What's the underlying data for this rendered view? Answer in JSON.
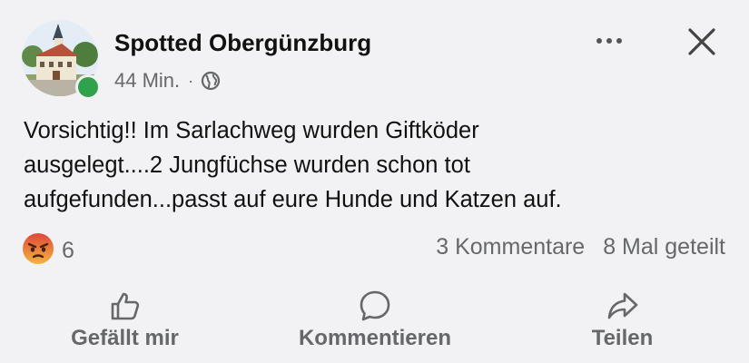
{
  "post": {
    "page_name": "Spotted Obergünzburg",
    "timestamp": "44 Min.",
    "separator": "·",
    "audience_icon": "globe-icon",
    "online_status_color": "#31a24c",
    "text_line1": "Vorsichtig!! Im Sarlachweg wurden Giftköder",
    "text_line2": "ausgelegt....2 Jungfüchse wurden schon tot",
    "text_line3": "aufgefunden...passt auf eure Hunde und Katzen auf."
  },
  "engagement": {
    "reaction_icon": "angry-reaction-icon",
    "reaction_count": "6",
    "comments": "3 Kommentare",
    "shares": "8 Mal geteilt"
  },
  "actions": {
    "like_label": "Gefällt mir",
    "comment_label": "Kommentieren",
    "share_label": "Teilen"
  },
  "colors": {
    "background": "#f2f2f4",
    "secondary_text": "#65676b",
    "angry_reaction": "#e8693b"
  }
}
